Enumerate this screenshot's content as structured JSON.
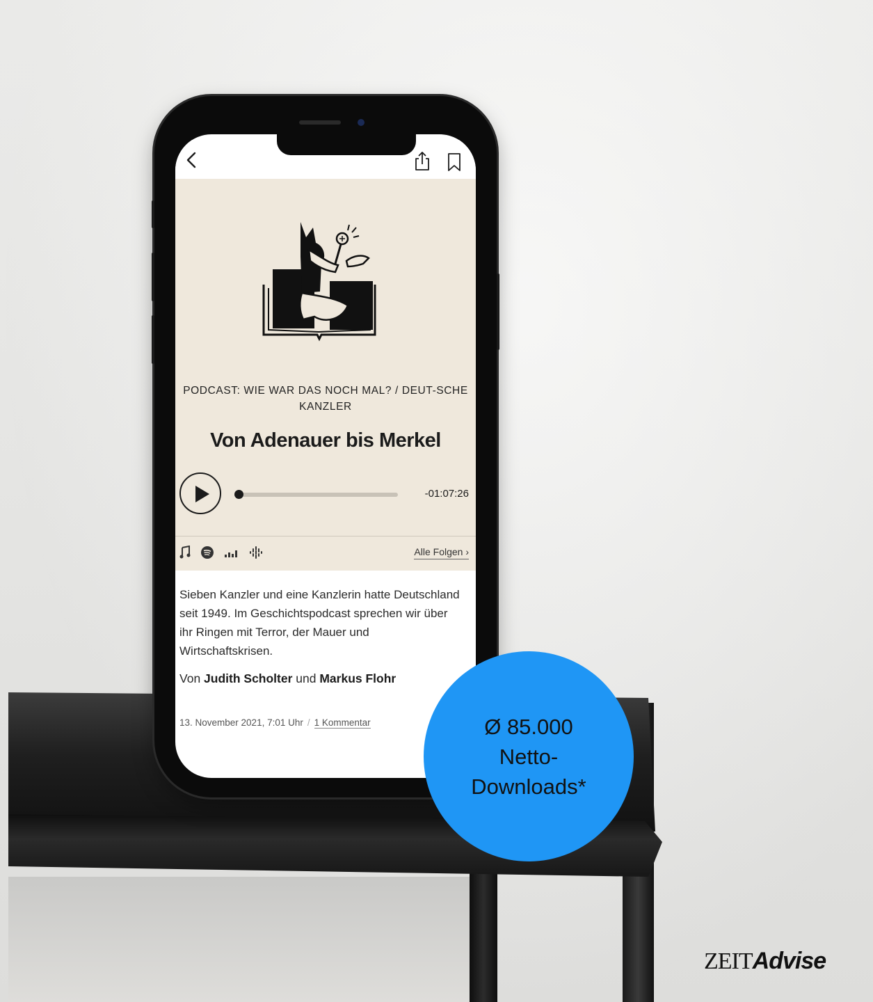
{
  "article": {
    "kicker": "PODCAST: WIE WAR DAS NOCH MAL? / DEUT-SCHE KANZLER",
    "headline": "Von Adenauer bis Merkel",
    "player": {
      "remaining_time": "-01:07:26",
      "progress": 0.02
    },
    "platform_icons": [
      "apple-podcasts-icon",
      "spotify-icon",
      "deezer-icon",
      "google-podcasts-icon"
    ],
    "all_episodes_label": "Alle Folgen ›",
    "body": "Sieben Kanzler und eine Kanzlerin hatte Deutschland seit 1949. Im Geschichtspodcast sprechen wir über ihr Ringen mit Terror, der Mauer und Wirtschaftskrisen.",
    "authors": {
      "prefix": "Von ",
      "author1": "Judith Scholter",
      "connector": " und ",
      "author2": "Markus Flohr"
    },
    "meta": {
      "date": "13. November 2021, 7:01 Uhr",
      "separator": "/",
      "comments": "1 Kommentar"
    }
  },
  "badge": {
    "line1": "Ø 85.000",
    "line2": "Netto-",
    "line3": "Downloads*"
  },
  "logo": {
    "part1": "ZEIT",
    "part2": "Advise"
  },
  "colors": {
    "badge": "#1f96f5",
    "hero_bg": "#efe8dc",
    "text": "#1b1b1b"
  }
}
